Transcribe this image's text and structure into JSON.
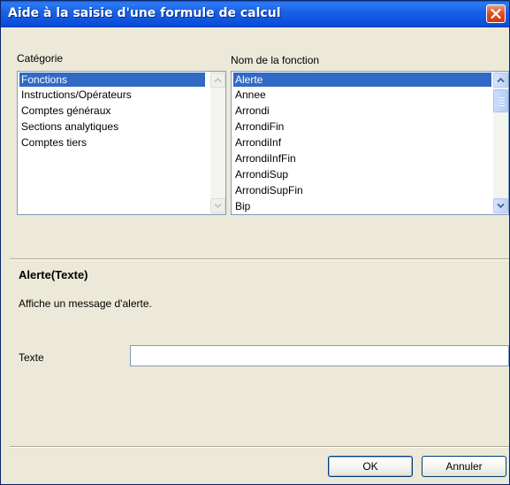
{
  "window": {
    "title": "Aide à la saisie d'une formule de calcul",
    "close_icon": "close-icon"
  },
  "categorie": {
    "label": "Catégorie",
    "items": [
      "Fonctions",
      "Instructions/Opérateurs",
      "Comptes généraux",
      "Sections analytiques",
      "Comptes tiers"
    ],
    "selected": "Fonctions"
  },
  "fonction": {
    "label": "Nom de la fonction",
    "items": [
      "Alerte",
      "Annee",
      "Arrondi",
      "ArrondiFin",
      "ArrondiInf",
      "ArrondiInfFin",
      "ArrondiSup",
      "ArrondiSupFin",
      "Bip"
    ],
    "selected": "Alerte"
  },
  "details": {
    "signature": "Alerte(Texte)",
    "description": "Affiche un message d'alerte.",
    "param_label": "Texte",
    "param_value": ""
  },
  "buttons": {
    "ok": "OK",
    "cancel": "Annuler"
  },
  "colors": {
    "titlebar": "#0b4dd8",
    "selection": "#316ac5",
    "dialog_bg": "#ece9d8"
  }
}
